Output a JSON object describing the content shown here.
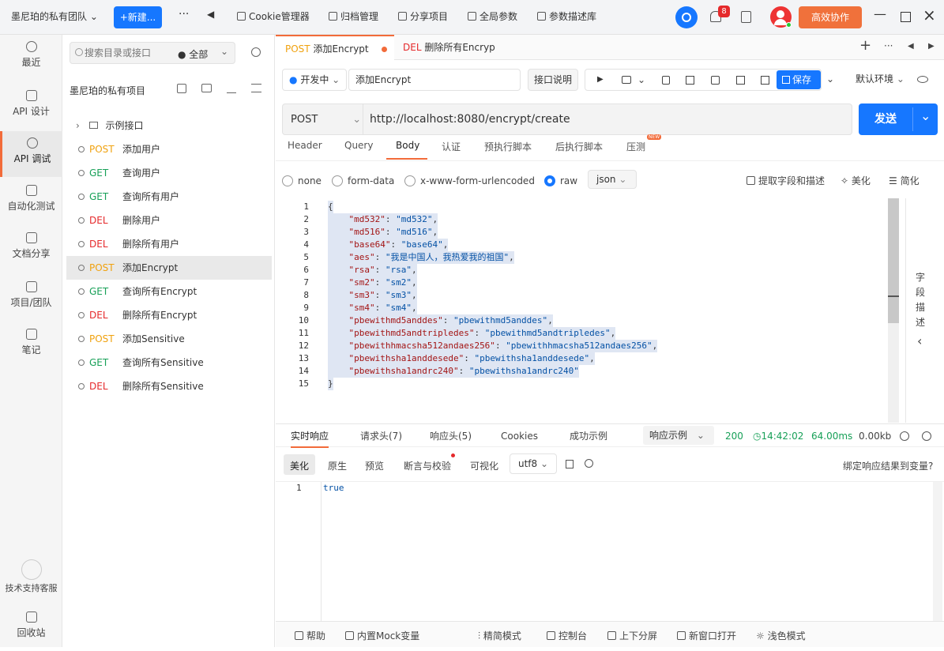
{
  "topbar": {
    "team": "墨尼珀的私有团队",
    "new_label": "+新建...",
    "items": [
      "Cookie管理器",
      "归档管理",
      "分享项目",
      "全局参数",
      "参数描述库"
    ],
    "badge": "8",
    "collab": "高效协作"
  },
  "leftnav": {
    "items": [
      "最近",
      "API 设计",
      "API 调试",
      "自动化测试",
      "文档分享",
      "项目/团队",
      "笔记"
    ],
    "support": "技术支持客服",
    "recycle": "回收站"
  },
  "tree": {
    "search_placeholder": "搜索目录或接口",
    "filter": "全部",
    "project": "墨尼珀的私有项目",
    "folder": "示例接口",
    "rows": [
      {
        "method": "POST",
        "name": "添加用户"
      },
      {
        "method": "GET",
        "name": "查询用户"
      },
      {
        "method": "GET",
        "name": "查询所有用户"
      },
      {
        "method": "DEL",
        "name": "删除用户"
      },
      {
        "method": "DEL",
        "name": "删除所有用户"
      },
      {
        "method": "POST",
        "name": "添加Encrypt"
      },
      {
        "method": "GET",
        "name": "查询所有Encrypt"
      },
      {
        "method": "DEL",
        "name": "删除所有Encrypt"
      },
      {
        "method": "POST",
        "name": "添加Sensitive"
      },
      {
        "method": "GET",
        "name": "查询所有Sensitive"
      },
      {
        "method": "DEL",
        "name": "删除所有Sensitive"
      }
    ]
  },
  "tabs": [
    {
      "method": "POST",
      "name": "添加Encrypt"
    },
    {
      "method": "DEL",
      "name": "删除所有Encryp"
    }
  ],
  "request": {
    "status": "开发中",
    "name": "添加Encrypt",
    "doc_label": "接口说明",
    "save_label": "保存",
    "env": "默认环境",
    "method": "POST",
    "url": "http://localhost:8080/encrypt/create",
    "send": "发送",
    "subtabs": [
      "Header",
      "Query",
      "Body",
      "认证",
      "预执行脚本",
      "后执行脚本",
      "压测"
    ],
    "new_badge": "NEW",
    "body_types": [
      "none",
      "form-data",
      "x-www-form-urlencoded",
      "raw"
    ],
    "format": "json",
    "extract": "提取字段和描述",
    "beautify": "美化",
    "simplify": "简化",
    "side_label": "字段描述"
  },
  "code_lines": [
    "{",
    "    \"md532\": \"md532\",",
    "    \"md516\": \"md516\",",
    "    \"base64\": \"base64\",",
    "    \"aes\": \"我是中国人，我热爱我的祖国\",",
    "    \"rsa\": \"rsa\",",
    "    \"sm2\": \"sm2\",",
    "    \"sm3\": \"sm3\",",
    "    \"sm4\": \"sm4\",",
    "    \"pbewithmd5anddes\": \"pbewithmd5anddes\",",
    "    \"pbewithmd5andtripledes\": \"pbewithmd5andtripledes\",",
    "    \"pbewithhmacsha512andaes256\": \"pbewithhmacsha512andaes256\",",
    "    \"pbewithsha1anddesede\": \"pbewithsha1anddesede\",",
    "    \"pbewithsha1andrc240\": \"pbewithsha1andrc240\"",
    "}"
  ],
  "response": {
    "tabs": [
      "实时响应",
      "请求头(7)",
      "响应头(5)",
      "Cookies",
      "成功示例"
    ],
    "example": "响应示例",
    "status": "200",
    "time": "14:42:02",
    "duration": "64.00ms",
    "size": "0.00kb",
    "view_tabs": [
      "美化",
      "原生",
      "预览",
      "断言与校验",
      "可视化"
    ],
    "encoding": "utf8",
    "bind": "绑定响应结果到变量?",
    "line": "1",
    "value": "true"
  },
  "bottom": [
    "帮助",
    "内置Mock变量",
    "精简模式",
    "控制台",
    "上下分屏",
    "新窗口打开",
    "浅色模式"
  ],
  "colors": {
    "post": "#f0a20f",
    "get": "#18a058",
    "del": "#e5292b",
    "accent": "#1677ff",
    "orange": "#f26b3a"
  }
}
